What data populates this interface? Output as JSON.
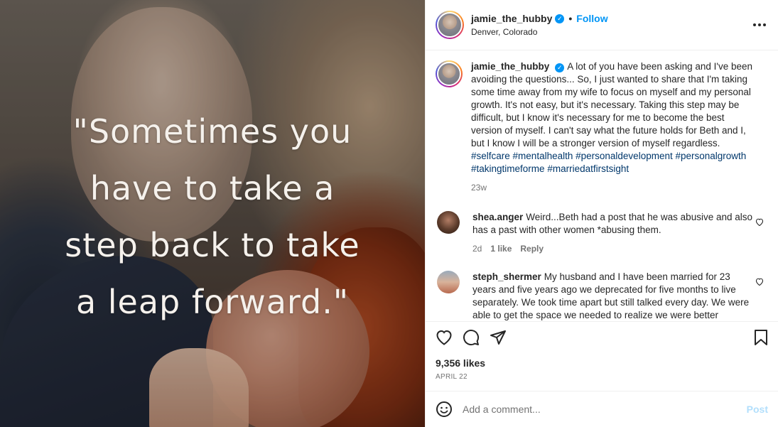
{
  "media": {
    "quote_lines": [
      "\"Sometimes you",
      "have to take a",
      "step back to take",
      "a leap forward.\""
    ]
  },
  "header": {
    "username": "jamie_the_hubby",
    "follow_label": "Follow",
    "separator": "•",
    "location": "Denver, Colorado",
    "more_icon": "more-horizontal-icon"
  },
  "caption": {
    "username": "jamie_the_hubby",
    "text": "A lot of you have been asking and I've been avoiding the questions... So, I just wanted to share that I'm taking some time away from my wife to focus on myself and my personal growth. It's not easy, but it's necessary. Taking this step may be difficult, but I know it's necessary for me to become the best version of myself. I can't say what the future holds for Beth and I, but I know I will be a stronger version of myself regardless.",
    "hashtags": [
      "#selfcare",
      "#mentalhealth",
      "#personaldevelopment",
      "#personalgrowth",
      "#takingtimeforme",
      "#marriedatfirstsight"
    ],
    "age": "23w"
  },
  "comments": [
    {
      "username": "shea.anger",
      "text": "Weird...Beth had a post that he was abusive and also has a past with other women *abusing them.",
      "age": "2d",
      "likes": "1 like",
      "reply": "Reply"
    },
    {
      "username": "steph_shermer",
      "text": "My husband and I have been married for 23 years and five years ago we deprecated for five months to live separately. We took time apart but still talked every day. We were able to get the space we needed to realize we were better"
    }
  ],
  "actions": {
    "likes": "9,356 likes",
    "date": "APRIL 22"
  },
  "composer": {
    "placeholder": "Add a comment...",
    "post_label": "Post"
  },
  "colors": {
    "accent": "#0095f6",
    "hashtag": "#00376b",
    "muted": "#737373",
    "post_disabled": "#b2dffc"
  }
}
